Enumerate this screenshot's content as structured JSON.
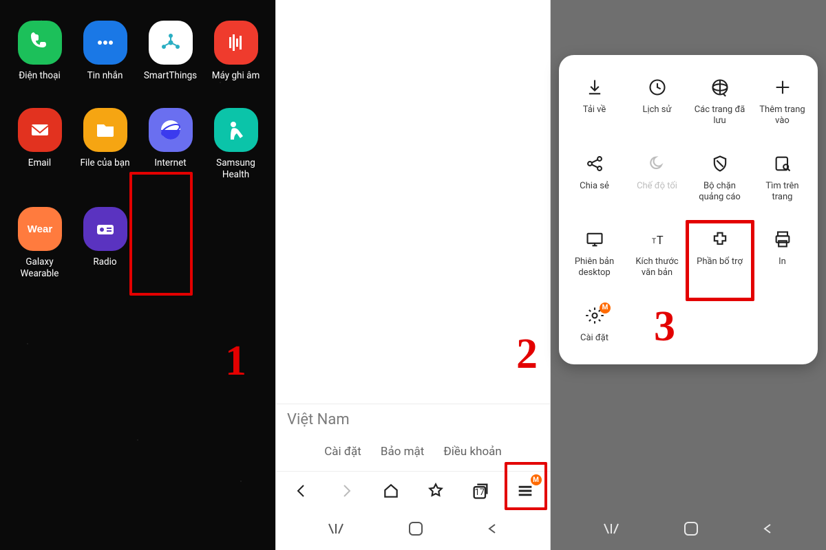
{
  "panel1": {
    "step": "1",
    "apps": [
      {
        "label": "Điện thoại",
        "color": "#1cc05a",
        "icon": "phone"
      },
      {
        "label": "Tin nhắn",
        "color": "#1a78e6",
        "icon": "chat"
      },
      {
        "label": "SmartThings",
        "color": "#ffffff",
        "icon": "smartthings"
      },
      {
        "label": "Máy ghi âm",
        "color": "#ef3b2d",
        "icon": "recorder"
      },
      {
        "label": "Email",
        "color": "#e2321f",
        "icon": "email"
      },
      {
        "label": "File của bạn",
        "color": "#f6a512",
        "icon": "files"
      },
      {
        "label": "Internet",
        "color": "#6a6ff0",
        "icon": "internet"
      },
      {
        "label": "Samsung\nHealth",
        "color": "#0bc4a9",
        "icon": "health"
      },
      {
        "label": "Galaxy\nWearable",
        "color": "#ff7b3e",
        "icon": "wear"
      },
      {
        "label": "Radio",
        "color": "#5a33c0",
        "icon": "radio"
      }
    ],
    "highlight_index": 6
  },
  "panel2": {
    "step": "2",
    "region": "Việt Nam",
    "links": [
      "Cài đặt",
      "Bảo mật",
      "Điều khoản"
    ],
    "tab_count": "17",
    "badge": "M",
    "toolbar": [
      "back",
      "forward",
      "home",
      "bookmark",
      "tabs",
      "menu"
    ]
  },
  "panel3": {
    "step": "3",
    "tools": [
      {
        "label": "Tải về",
        "icon": "download"
      },
      {
        "label": "Lịch sử",
        "icon": "history"
      },
      {
        "label": "Các trang đã\nlưu",
        "icon": "savedpages"
      },
      {
        "label": "Thêm trang\nvào",
        "icon": "plus"
      },
      {
        "label": "Chia sẻ",
        "icon": "share"
      },
      {
        "label": "Chế độ tối",
        "icon": "moon",
        "dim": true
      },
      {
        "label": "Bộ chặn\nquảng cáo",
        "icon": "shield"
      },
      {
        "label": "Tìm trên\ntrang",
        "icon": "find"
      },
      {
        "label": "Phiên bản\ndesktop",
        "icon": "desktop"
      },
      {
        "label": "Kích thước\nvăn bản",
        "icon": "textsize"
      },
      {
        "label": "Phần bổ trợ",
        "icon": "addon"
      },
      {
        "label": "In",
        "icon": "print"
      },
      {
        "label": "Cài đặt",
        "icon": "settings",
        "badge": "M"
      }
    ],
    "highlight_index": 6
  }
}
